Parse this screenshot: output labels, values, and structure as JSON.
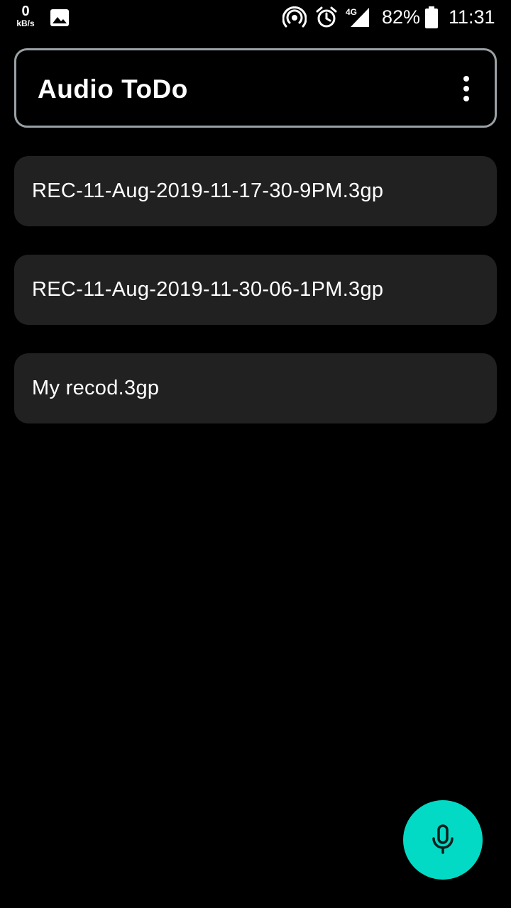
{
  "status_bar": {
    "net_speed_value": "0",
    "net_speed_unit": "kB/s",
    "network_type": "4G",
    "battery_percent": "82%",
    "time": "11:31",
    "icons": [
      "gallery-icon",
      "hotspot-icon",
      "alarm-icon",
      "signal-icon",
      "battery-icon"
    ]
  },
  "app_bar": {
    "title": "Audio ToDo",
    "menu_icon": "more-vert-icon"
  },
  "recordings": [
    {
      "name": "REC-11-Aug-2019-11-17-30-9PM.3gp"
    },
    {
      "name": "REC-11-Aug-2019-11-30-06-1PM.3gp"
    },
    {
      "name": "My recod.3gp"
    }
  ],
  "fab": {
    "icon": "microphone-icon",
    "color": "#03dac5"
  },
  "colors": {
    "background": "#000000",
    "card": "#212121",
    "app_bar_border": "#9aa1a4",
    "accent": "#03dac5",
    "text": "#ffffff"
  }
}
